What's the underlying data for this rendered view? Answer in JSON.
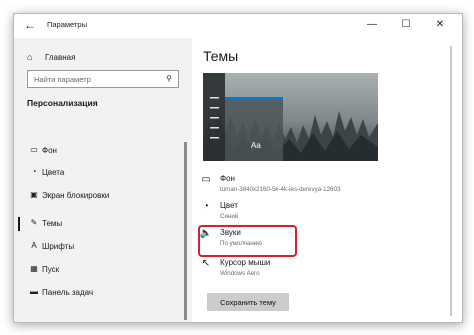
{
  "window": {
    "title": "Параметры",
    "controls": {
      "minimize": "—",
      "maximize": "☐",
      "close": "✕"
    }
  },
  "sidebar": {
    "home_label": "Главная",
    "search_placeholder": "Найти параметр",
    "section_title": "Персонализация",
    "items": [
      {
        "label": "Фон",
        "icon": "image-icon"
      },
      {
        "label": "Цвета",
        "icon": "palette-icon"
      },
      {
        "label": "Экран блокировки",
        "icon": "lock-screen-icon"
      },
      {
        "label": "Темы",
        "icon": "brush-icon",
        "selected": true
      },
      {
        "label": "Шрифты",
        "icon": "font-icon"
      },
      {
        "label": "Пуск",
        "icon": "start-icon"
      },
      {
        "label": "Панель задач",
        "icon": "taskbar-icon"
      }
    ]
  },
  "main": {
    "title": "Темы",
    "preview_sample_text": "Aa",
    "options": [
      {
        "title": "Фон",
        "subtitle": "tuman-3840x2160-5k-4k-les-derevya-12603",
        "icon": "image-icon"
      },
      {
        "title": "Цвет",
        "subtitle": "Синий",
        "icon": "palette-icon"
      },
      {
        "title": "Звуки",
        "subtitle": "По умолчанию",
        "icon": "speaker-icon"
      },
      {
        "title": "Курсор мыши",
        "subtitle": "Windows Aero",
        "icon": "cursor-icon"
      }
    ],
    "save_button": "Сохранить тему"
  },
  "colors": {
    "highlight": "#d6202f",
    "sidebar_bg": "#f2f2f2",
    "preview_accent": "#0078d7"
  }
}
